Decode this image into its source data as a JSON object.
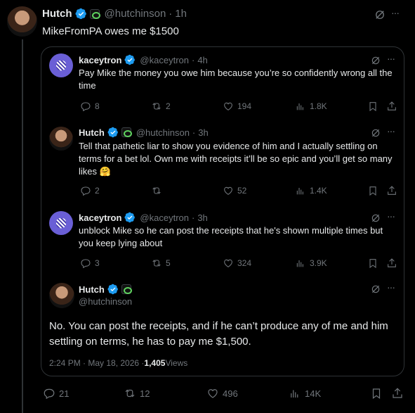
{
  "main_post": {
    "author_name": "Hutch",
    "handle": "@hutchinson",
    "time": "1h",
    "text": "MikeFromPA owes me $1500"
  },
  "replies": [
    {
      "author_name": "kaceytron",
      "handle": "@kaceytron",
      "time": "4h",
      "text": "Pay Mike the money you owe him because you’re so confidently wrong all the time",
      "replies": "8",
      "reposts": "2",
      "likes": "194",
      "views": "1.8K"
    },
    {
      "author_name": "Hutch",
      "handle": "@hutchinson",
      "time": "3h",
      "text": "Tell that pathetic liar to show you evidence of him and I actually settling on terms for a bet lol. Own me with receipts it’ll be so epic and you’ll get so many likes 🤗",
      "replies": "2",
      "reposts": "",
      "likes": "52",
      "views": "1.4K"
    },
    {
      "author_name": "kaceytron",
      "handle": "@kaceytron",
      "time": "3h",
      "text": "unblock Mike so he can post the receipts that he's shown multiple times but you keep lying about",
      "replies": "3",
      "reposts": "5",
      "likes": "324",
      "views": "3.9K"
    }
  ],
  "focused": {
    "author_name": "Hutch",
    "handle": "@hutchinson",
    "text": "No. You can post the receipts, and if he can’t produce any of me and him settling on terms, he has to pay me $1,500.",
    "timestamp": "2:24 PM · May 18, 2026 · ",
    "views_count": "1,405",
    "views_label": " Views"
  },
  "main_actions": {
    "replies": "21",
    "reposts": "12",
    "likes": "496",
    "views": "14K"
  },
  "ui": {
    "dot_sep": "·",
    "more_dots": "···"
  },
  "colors": {
    "verified": "#1d9bf0",
    "muted": "#71767b",
    "border": "#2f3336"
  }
}
